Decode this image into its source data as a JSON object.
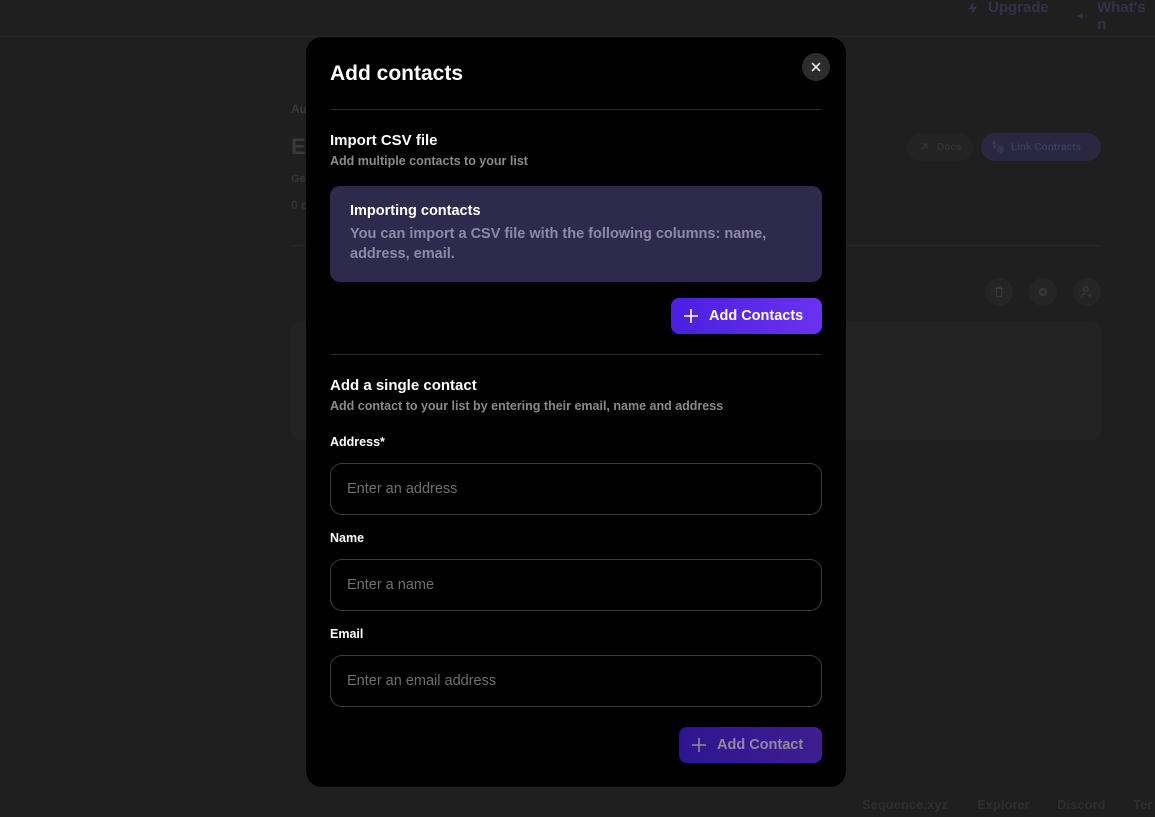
{
  "background": {
    "topbar": {
      "upgrade_label": "Upgrade",
      "whats_new_label": "What's n"
    },
    "breadcrumb": "Au",
    "title": "Ex",
    "subtitle": "Ge",
    "count": "0 c",
    "actions": {
      "docs_label": "Docs",
      "link_contracts_label": "Link Contracts"
    },
    "footer_links": [
      "Sequence.xyz",
      "Explorer",
      "Discord",
      "Ter"
    ]
  },
  "modal": {
    "title": "Add contacts",
    "import_section": {
      "title": "Import CSV file",
      "description": "Add multiple contacts to your list",
      "info_title": "Importing contacts",
      "info_text": "You can import a CSV file with the following columns: name, address, email.",
      "button_label": "Add Contacts"
    },
    "single_section": {
      "title": "Add a single contact",
      "description": "Add contact to your list by entering their email, name and address",
      "fields": [
        {
          "label": "Address*",
          "value": "",
          "placeholder": "Enter an address"
        },
        {
          "label": "Name",
          "value": "",
          "placeholder": "Enter a name"
        },
        {
          "label": "Email",
          "value": "",
          "placeholder": "Enter an email address"
        }
      ],
      "button_label": "Add Contact"
    }
  },
  "colors": {
    "accent": "#5b28eb",
    "info_box": "#2e2a4d",
    "modal_bg": "#000000",
    "overlay_bg": "#1f1f1f"
  }
}
